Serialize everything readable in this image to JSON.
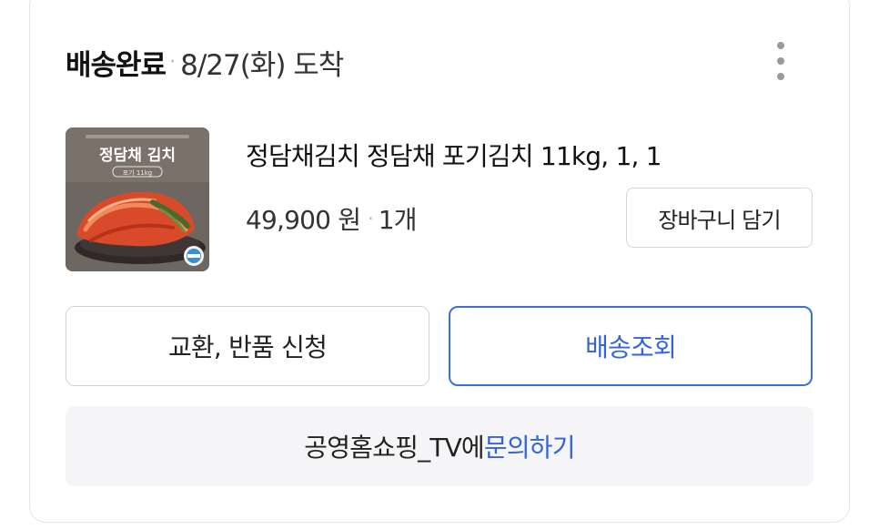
{
  "order": {
    "status": "배송완료",
    "date": "8/27(화) 도착"
  },
  "more_menu": {
    "icon": "more-vertical-icon"
  },
  "product": {
    "image_label_title": "정담채 김치",
    "image_label_sub": "포기 11kg",
    "name": "정담채김치 정담채 포기김치 11kg, 1, 1",
    "price": "49,900 원",
    "quantity": "1개"
  },
  "buttons": {
    "add_to_cart": "장바구니 담기",
    "return_exchange": "교환, 반품 신청",
    "track_delivery": "배송조회"
  },
  "inquiry": {
    "seller": "공영홈쇼핑_TV에",
    "link": "문의하기"
  },
  "colors": {
    "accent": "#3464d6",
    "border": "#d4d4d4",
    "inquiry_bg": "#f5f5f7"
  }
}
